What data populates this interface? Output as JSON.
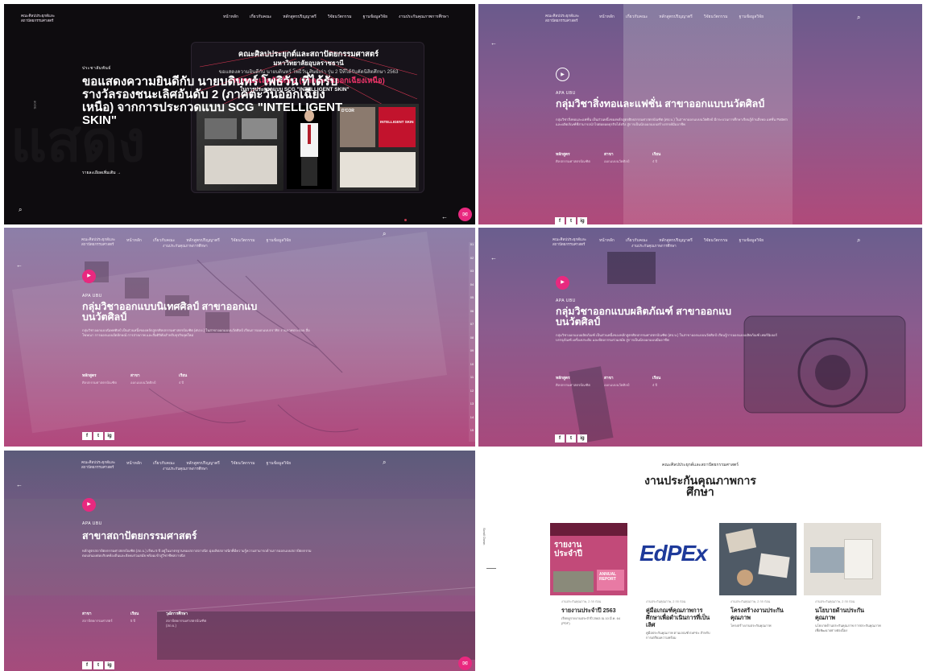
{
  "nav": {
    "logo_line1": "คณะศิลปประยุกต์และ",
    "logo_line2": "สถาปัตยกรรมศาสตร์",
    "items": [
      "หน้าหลัก",
      "เกี่ยวกับคณะ",
      "หลักสูตรปริญญาตรี",
      "วิจัยนวัตกรรม",
      "ฐานข้อมูลวิจัย",
      "งานประกันคุณภาพการศึกษา"
    ],
    "sub_item": "งานประกันคุณภาพการศึกษา"
  },
  "hero": {
    "eyebrow": "ประชาสัมพันธ์",
    "headline": "ขอแสดงความยินดีกับ นายบดินทร์ โพธิวัน ที่ได้รับรางวัลรองชนะเลิศอันดับ 2 (ภาคตะวันออกเฉียงเหนือ) จากการประกวดแบบ SCG \"INTELLIGENT SKIN\"",
    "read_more": "รายละเอียดเพิ่มเติม →",
    "card_header_1": "คณะศิลปประยุกต์และสถาปัตยกรรมศาสตร์",
    "card_header_2": "มหาวิทยาลัยอุบลราชธานี",
    "card_sub": "ขอแสดงความยินดีกับ นายบดินทร์ โพธิวัน ศิษย์เก่า รุ่น 2 ปีที่ได้รับคัดนิสิตศึกษา 2563",
    "card_award": "รองชนะเลิศอันดับ 2 (ภาคตะวันออกเฉียงเหนือ)",
    "card_contest": "ในการประกวดแบบ SCG \"INTELLIGENT SKIN\"",
    "scroll_label": "Scroll",
    "poster_title": "INTELLIGENT SKIN",
    "poster_brand": "D'COR"
  },
  "programs": [
    {
      "eyebrow": "APA UBU",
      "title": "กลุ่มวิชาสิ่งทอและแฟชั่น สาขาออกแบบนวัตศิลป์",
      "desc": "กลุ่มวิชาสิ่งทอและแฟชั่น เป็นส่วนหนึ่งของหลักสูตรศิลปกรรมศาสตรบัณฑิต (ศป.บ.) ในสาขาออกแบบนวัตศิลป์ มีกระบวนการศึกษาเรียนรู้ด้านสิ่งทอ แฟชั่น Pattern และผลิตภัณฑ์ที่สามารถนำไปต่อยอดธุรกิจได้จริง สู่การเป็นนักออกแบบสร้างสรรค์มืออาชีพ",
      "facts": [
        {
          "k": "หลักสูตร",
          "v": "ศิลปกรรมศาสตรบัณฑิต"
        },
        {
          "k": "สาขา",
          "v": "ออกแบบนวัตศิลป์"
        },
        {
          "k": "เรียน",
          "v": "4 ปี"
        }
      ]
    },
    {
      "eyebrow": "APA UBU",
      "title": "กลุ่มวิชาออกแบบนิเทศศิลป์ สาขาออกแบบนวัตศิลป์",
      "desc": "กลุ่มวิชาออกแบบนิเทศศิลป์ เป็นส่วนหนึ่งของหลักสูตรศิลปกรรมศาสตรบัณฑิต (ศป.บ.) ในสาขาออกแบบนวัตศิลป์ เรียนการออกแบบกราฟิก งานภาพประกอบ สื่อโฆษณา การออกแบบอัตลักษณ์ การถ่ายภาพ และสื่อดิจิทัลสำหรับธุรกิจยุคใหม่",
      "facts": [
        {
          "k": "หลักสูตร",
          "v": "ศิลปกรรมศาสตรบัณฑิต"
        },
        {
          "k": "สาขา",
          "v": "ออกแบบนวัตศิลป์"
        },
        {
          "k": "เรียน",
          "v": "4 ปี"
        }
      ]
    },
    {
      "eyebrow": "APA UBU",
      "title": "กลุ่มวิชาออกแบบผลิตภัณฑ์ สาขาออกแบบนวัตศิลป์",
      "desc": "กลุ่มวิชาออกแบบผลิตภัณฑ์ เป็นส่วนหนึ่งของหลักสูตรศิลปกรรมศาสตรบัณฑิต (ศป.บ.) ในสาขาออกแบบนวัตศิลป์ เรียนรู้การออกแบบผลิตภัณฑ์ เฟอร์นิเจอร์ บรรจุภัณฑ์ เครื่องประดับ และหัตถกรรมร่วมสมัย สู่การเป็นนักออกแบบมืออาชีพ",
      "facts": [
        {
          "k": "หลักสูตร",
          "v": "ศิลปกรรมศาสตรบัณฑิต"
        },
        {
          "k": "สาขา",
          "v": "ออกแบบนวัตศิลป์"
        },
        {
          "k": "เรียน",
          "v": "4 ปี"
        }
      ]
    },
    {
      "eyebrow": "APA UBU",
      "title": "สาขาสถาปัตยกรรมศาสตร์",
      "desc": "หลักสูตรสถาปัตยกรรมศาสตรบัณฑิต (สถ.บ.) เรียน 5 ปี อยู่ในมาตรฐานของสภาสถาปนิก มุ่งผลิตสถาปนิกที่มีความรู้ความสามารถด้านการออกแบบสถาปัตยกรรม ตอบสนองต่อบริบทท้องถิ่นและสังคมร่วมสมัย พร้อมเข้าสู่วิชาชีพสถาปนิก",
      "facts": [
        {
          "k": "สาขา",
          "v": "สถาปัตยกรรมศาสตร์"
        },
        {
          "k": "เรียน",
          "v": "5 ปี"
        },
        {
          "k": "วุฒิการศึกษา",
          "v": "สถาปัตยกรรมศาสตรบัณฑิต (สถ.บ.)"
        }
      ]
    }
  ],
  "social": [
    "f",
    "t",
    "ig"
  ],
  "pager": [
    "01",
    "02",
    "03",
    "04",
    "05",
    "06",
    "07",
    "08",
    "09",
    "10",
    "11",
    "12",
    "13",
    "14",
    "15",
    "16"
  ],
  "qa": {
    "overline": "คณะศิลปประยุกต์และสถาปัตยกรรมศาสตร์",
    "title_line1": "งานประกันคุณภาพการ",
    "title_line2": "ศึกษา",
    "scroll_label": "Scroll Down",
    "cards": [
      {
        "meta": "งานประกันคุณภาพ, 2 กก ก่อน",
        "title": "รายงานประจำปี 2563",
        "desc": "เรียกดูรายงานประจำปี 2563 ณ 10 มี.ค. 64 (PDF)",
        "thumb_title": "รายงาน ประจำปี",
        "thumb_sub": "ANNUAL REPORT"
      },
      {
        "meta": "งานประกันคุณภาพ, 2 กก ก่อน",
        "title": "คู่มือเกณฑ์คุณภาพการศึกษาเพื่อดำเนินการที่เป็นเลิศ",
        "desc": "คู่มือประกันคุณภาพ ตามเกณฑ์ EdPEx สำหรับการเตรียมความพร้อม",
        "thumb_title": "EdPEx",
        "thumb_sub": ""
      },
      {
        "meta": "งานประกันคุณภาพ, 2 กก ก่อน",
        "title": "โครงสร้างงานประกันคุณภาพ",
        "desc": "โครงสร้างงานประกันคุณภาพ",
        "thumb_title": "",
        "thumb_sub": ""
      },
      {
        "meta": "งานประกันคุณภาพ, 2 กก ก่อน",
        "title": "นโยบายด้านประกันคุณภาพ",
        "desc": "นโยบายด้านประกันคุณภาพ การประกันคุณภาพเพื่อพัฒนาอย่างต่อเนื่อง",
        "thumb_title": "",
        "thumb_sub": ""
      }
    ]
  },
  "colors": {
    "accent": "#e8297f",
    "messenger": "#e8297f"
  }
}
